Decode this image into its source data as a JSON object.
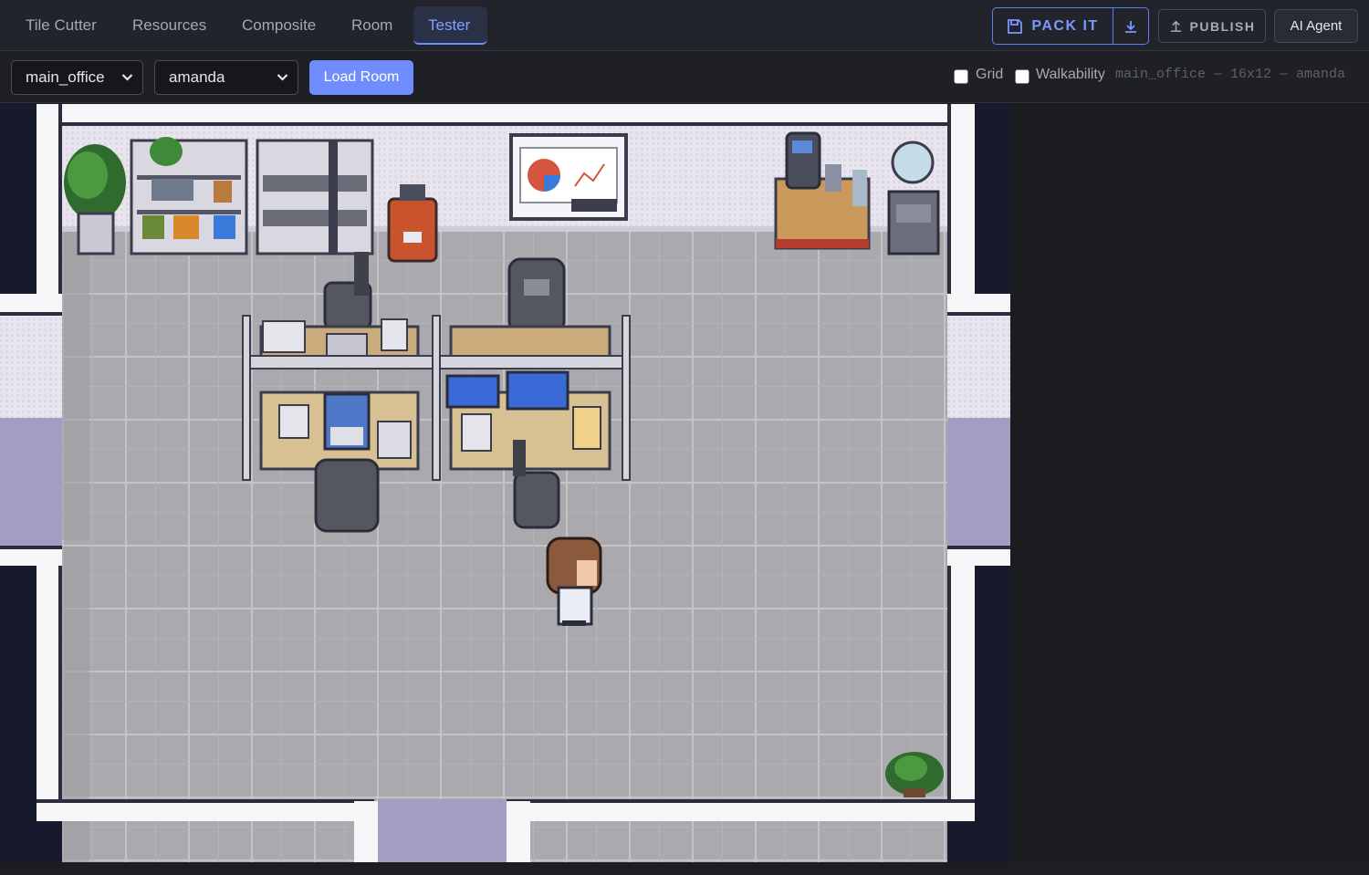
{
  "nav": {
    "tabs": [
      {
        "label": "Tile Cutter",
        "active": false
      },
      {
        "label": "Resources",
        "active": false
      },
      {
        "label": "Composite",
        "active": false
      },
      {
        "label": "Room",
        "active": false
      },
      {
        "label": "Tester",
        "active": true
      }
    ],
    "pack_label": "PACK IT",
    "publish_label": "PUBLISH",
    "agent_label": "AI Agent"
  },
  "toolbar": {
    "room_select": {
      "value": "main_office"
    },
    "character_select": {
      "value": "amanda"
    },
    "load_label": "Load Room",
    "grid": {
      "label": "Grid",
      "checked": false
    },
    "walkability": {
      "label": "Walkability",
      "checked": false
    },
    "info": "main_office — 16x12 — amanda"
  },
  "colors": {
    "accent": "#6f8dff",
    "floor": "#a9a9ad",
    "wall": "#f4f3f7",
    "door": "#a59cc2",
    "void": "#171a2c"
  },
  "icons": {
    "pack": "floppy-disk-icon",
    "download": "download-icon",
    "publish": "upload-icon",
    "select": "chevron-down-icon"
  }
}
